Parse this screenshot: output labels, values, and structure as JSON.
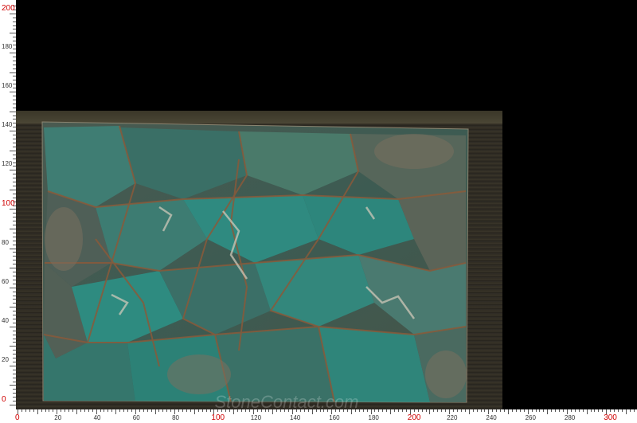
{
  "image": {
    "subject": "natural-stone-slab",
    "watermark": "StoneContact.com"
  },
  "ruler_y": {
    "labels": [
      {
        "value": "0",
        "red": true
      },
      {
        "value": "20",
        "red": false
      },
      {
        "value": "40",
        "red": false
      },
      {
        "value": "60",
        "red": false
      },
      {
        "value": "80",
        "red": false
      },
      {
        "value": "100",
        "red": true
      },
      {
        "value": "120",
        "red": false
      },
      {
        "value": "140",
        "red": false
      },
      {
        "value": "160",
        "red": false
      },
      {
        "value": "180",
        "red": false
      },
      {
        "value": "200",
        "red": true
      }
    ]
  },
  "ruler_x": {
    "labels": [
      {
        "value": "0",
        "red": true
      },
      {
        "value": "20",
        "red": false
      },
      {
        "value": "40",
        "red": false
      },
      {
        "value": "60",
        "red": false
      },
      {
        "value": "80",
        "red": false
      },
      {
        "value": "100",
        "red": true
      },
      {
        "value": "120",
        "red": false
      },
      {
        "value": "140",
        "red": false
      },
      {
        "value": "160",
        "red": false
      },
      {
        "value": "180",
        "red": false
      },
      {
        "value": "200",
        "red": true
      },
      {
        "value": "220",
        "red": false
      },
      {
        "value": "240",
        "red": false
      },
      {
        "value": "260",
        "red": false
      },
      {
        "value": "280",
        "red": false
      },
      {
        "value": "300",
        "red": true
      }
    ]
  },
  "colors": {
    "background": "#000000",
    "ruler_background": "#ffffff",
    "ruler_major_label": "#d00000",
    "ruler_minor_label": "#333333",
    "slab_base": "#3f5a4f",
    "slab_teal": "#2f8a80",
    "slab_vein_rust": "#8a5a3a",
    "slab_vein_white": "#d8cdbd"
  }
}
